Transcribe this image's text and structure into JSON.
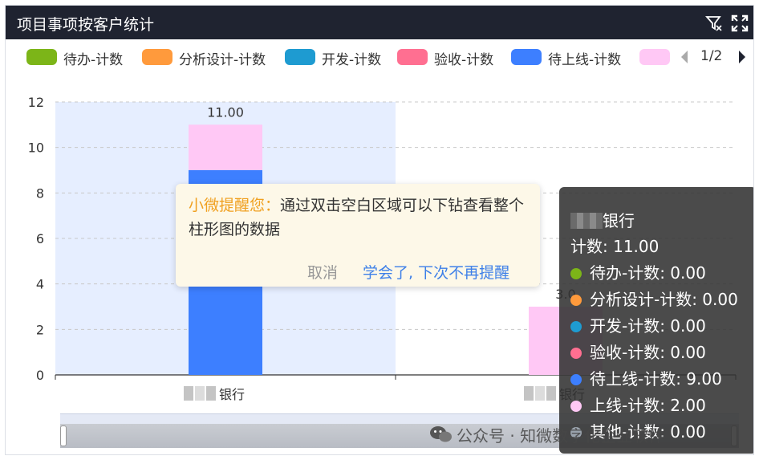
{
  "header": {
    "title": "项目事项按客户统计",
    "filter_icon": "filter-icon",
    "fullscreen_icon": "fullscreen-icon"
  },
  "legend": {
    "items": [
      {
        "label": "待办-计数",
        "color": "#7cb518"
      },
      {
        "label": "分析设计-计数",
        "color": "#ff9a3c"
      },
      {
        "label": "开发-计数",
        "color": "#1e9bd1"
      },
      {
        "label": "验收-计数",
        "color": "#ff6f91"
      },
      {
        "label": "待上线-计数",
        "color": "#3d7fff"
      },
      {
        "label": "",
        "color": "#ffc8f5"
      }
    ],
    "page": "1/2",
    "prev_icon": "triangle-left-icon",
    "next_icon": "triangle-right-icon"
  },
  "chart_data": {
    "type": "bar",
    "stacked": true,
    "categories": [
      "银行",
      "银行"
    ],
    "series": [
      {
        "name": "待办-计数",
        "color": "#7cb518",
        "values": [
          0,
          0
        ]
      },
      {
        "name": "分析设计-计数",
        "color": "#ff9a3c",
        "values": [
          0,
          0
        ]
      },
      {
        "name": "开发-计数",
        "color": "#1e9bd1",
        "values": [
          0,
          0
        ]
      },
      {
        "name": "验收-计数",
        "color": "#ff6f91",
        "values": [
          0,
          0
        ]
      },
      {
        "name": "待上线-计数",
        "color": "#3d7fff",
        "values": [
          9,
          0
        ]
      },
      {
        "name": "上线-计数",
        "color": "#ffc8f5",
        "values": [
          2,
          3
        ]
      }
    ],
    "totals": [
      "11.00",
      "3.0"
    ],
    "ylim": [
      0,
      12
    ],
    "yticks": [
      0,
      2,
      4,
      6,
      8,
      10,
      12
    ],
    "grid": true,
    "highlight_category": 0,
    "highlight_color": "#e6eeff"
  },
  "hint_tooltip": {
    "prefix": "小微提醒您：",
    "message": "通过双击空白区域可以下钻查看整个柱形图的数据",
    "cancel": "取消",
    "confirm": "学会了, 下次不再提醒"
  },
  "data_tooltip": {
    "category": "银行",
    "total": "计数: 11.00",
    "rows": [
      {
        "label": "待办-计数: 0.00",
        "color": "#7cb518"
      },
      {
        "label": "分析设计-计数: 0.00",
        "color": "#ff9a3c"
      },
      {
        "label": "开发-计数: 0.00",
        "color": "#1e9bd1"
      },
      {
        "label": "验收-计数: 0.00",
        "color": "#ff6f91"
      },
      {
        "label": "待上线-计数: 9.00",
        "color": "#3d7fff"
      },
      {
        "label": "上线-计数: 2.00",
        "color": "#ffc8f5"
      },
      {
        "label": "其他-计数: 0.00",
        "color": "#9aa3ad"
      }
    ]
  },
  "watermark": "公众号 · 知微数字化企业软件"
}
